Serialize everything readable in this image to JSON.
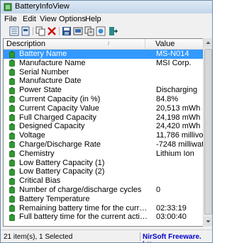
{
  "window": {
    "title": "BatteryInfoView"
  },
  "menu": [
    "File",
    "Edit",
    "View",
    "Options",
    "Help"
  ],
  "toolbar": [
    "properties-icon",
    "report-icon",
    "copy-icon",
    "delete-icon",
    "save-icon",
    "export-icon",
    "copy-rows-icon",
    "html-report-icon",
    "exit-icon"
  ],
  "columns": {
    "description": "Description",
    "value": "Value",
    "sort": "/"
  },
  "rows": [
    {
      "description": "Battery Name",
      "value": "MS-N014"
    },
    {
      "description": "Manufacture Name",
      "value": "MSI Corp."
    },
    {
      "description": "Serial Number",
      "value": ""
    },
    {
      "description": "Manufacture Date",
      "value": ""
    },
    {
      "description": "Power State",
      "value": "Discharging"
    },
    {
      "description": "Current Capacity (in %)",
      "value": "84.8%"
    },
    {
      "description": "Current Capacity Value",
      "value": "20,513 mWh"
    },
    {
      "description": "Full Charged Capacity",
      "value": "24,198 mWh"
    },
    {
      "description": "Designed Capacity",
      "value": "24,420 mWh"
    },
    {
      "description": "Voltage",
      "value": "11,786 millivolts"
    },
    {
      "description": "Charge/Discharge Rate",
      "value": "-7248 milliwatts"
    },
    {
      "description": "Chemistry",
      "value": "Lithium Ion"
    },
    {
      "description": "Low Battery Capacity (1)",
      "value": ""
    },
    {
      "description": "Low Battery Capacity (2)",
      "value": ""
    },
    {
      "description": "Critical Bias",
      "value": ""
    },
    {
      "description": "Number of charge/discharge cycles",
      "value": "0"
    },
    {
      "description": "Battery Temperature",
      "value": ""
    },
    {
      "description": "Remaining battery time for the current activity (Esti...",
      "value": "02:33:19"
    },
    {
      "description": "Full battery time for the current activity (Estimated)",
      "value": "03:00:40"
    }
  ],
  "selected_row": 0,
  "status": {
    "count": "21 item(s), 1 Selected",
    "link": "NirSoft Freeware.  http"
  },
  "colors": {
    "selection": "#3399ff",
    "row_icon": "#2f9a2f",
    "link": "#0000cc"
  }
}
